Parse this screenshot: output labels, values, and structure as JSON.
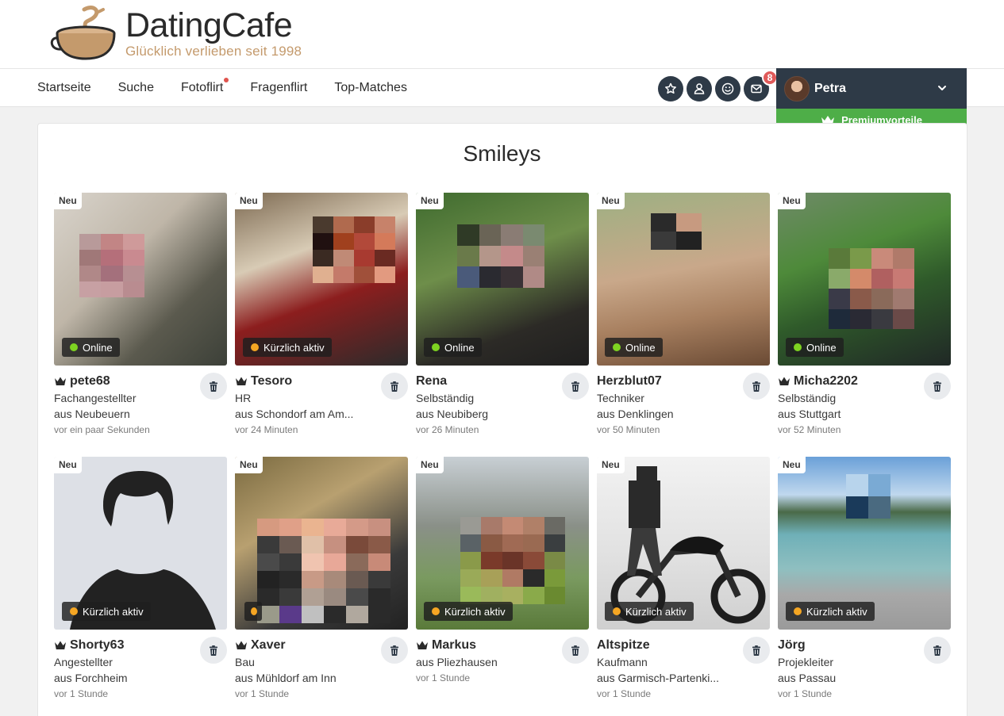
{
  "logo": {
    "name": "DatingCafe",
    "tagline": "Glücklich verlieben seit 1998"
  },
  "nav": [
    {
      "label": "Startseite",
      "dot": false
    },
    {
      "label": "Suche",
      "dot": false
    },
    {
      "label": "Fotoflirt",
      "dot": true
    },
    {
      "label": "Fragenflirt",
      "dot": false
    },
    {
      "label": "Top-Matches",
      "dot": false
    }
  ],
  "icons": [
    {
      "name": "favorites-star-icon"
    },
    {
      "name": "profile-person-icon"
    },
    {
      "name": "smiley-icon"
    },
    {
      "name": "messages-envelope-icon",
      "badge": "8"
    }
  ],
  "user": {
    "name": "Petra",
    "premium_label": "Premiumvorteile"
  },
  "colors": {
    "online": "#7ed321",
    "recent": "#f5a623",
    "premium": "#4eae48",
    "dark": "#2e3a47"
  },
  "page": {
    "title": "Smileys"
  },
  "profiles": [
    {
      "name": "pete68",
      "premium": true,
      "new_label": "Neu",
      "status": "Online",
      "status_type": "online",
      "lines": [
        "Fachangestellter",
        "aus Neubeuern"
      ],
      "time": "vor ein paar Sekunden"
    },
    {
      "name": "Tesoro",
      "premium": true,
      "new_label": "Neu",
      "status": "Kürzlich aktiv",
      "status_type": "recent",
      "lines": [
        "HR",
        "aus Schondorf am Am..."
      ],
      "time": "vor 24 Minuten"
    },
    {
      "name": "Rena",
      "premium": false,
      "new_label": "Neu",
      "status": "Online",
      "status_type": "online",
      "lines": [
        "Selbständig",
        "aus Neubiberg"
      ],
      "time": "vor 26 Minuten"
    },
    {
      "name": "Herzblut07",
      "premium": false,
      "new_label": "Neu",
      "status": "Online",
      "status_type": "online",
      "lines": [
        "Techniker",
        "aus Denklingen"
      ],
      "time": "vor 50 Minuten"
    },
    {
      "name": "Micha2202",
      "premium": true,
      "new_label": "Neu",
      "status": "Online",
      "status_type": "online",
      "lines": [
        "Selbständig",
        "aus Stuttgart"
      ],
      "time": "vor 52 Minuten"
    },
    {
      "name": "Shorty63",
      "premium": true,
      "new_label": "Neu",
      "status": "Kürzlich aktiv",
      "status_type": "recent",
      "lines": [
        "Angestellter",
        "aus Forchheim"
      ],
      "time": "vor 1 Stunde"
    },
    {
      "name": "Xaver",
      "premium": true,
      "new_label": "Neu",
      "status": "",
      "status_type": "recent",
      "lines": [
        "Bau",
        "aus Mühldorf am Inn"
      ],
      "time": "vor 1 Stunde"
    },
    {
      "name": "Markus",
      "premium": true,
      "new_label": "Neu",
      "status": "Kürzlich aktiv",
      "status_type": "recent",
      "lines": [
        "aus Pliezhausen"
      ],
      "time": "vor 1 Stunde"
    },
    {
      "name": "Altspitze",
      "premium": false,
      "new_label": "Neu",
      "status": "Kürzlich aktiv",
      "status_type": "recent",
      "lines": [
        "Kaufmann",
        "aus Garmisch-Partenki..."
      ],
      "time": "vor 1 Stunde"
    },
    {
      "name": "Jörg",
      "premium": false,
      "new_label": "Neu",
      "status": "Kürzlich aktiv",
      "status_type": "recent",
      "lines": [
        "Projekleiter",
        "aus Passau"
      ],
      "time": "vor 1 Stunde"
    }
  ]
}
